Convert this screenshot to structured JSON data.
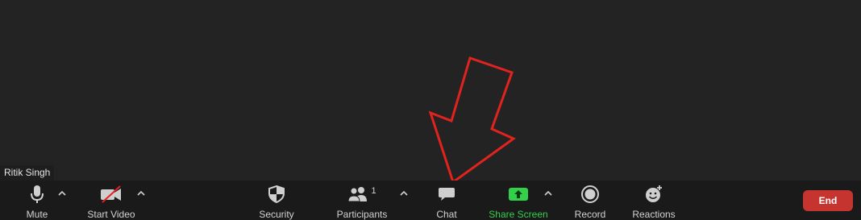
{
  "participant_name": "Ritik Singh",
  "colors": {
    "background": "#232323",
    "toolbar": "#1a1a1a",
    "end_button": "#c5342f",
    "share_screen": "#33d04a",
    "annotation_arrow": "#e0231f"
  },
  "toolbar": {
    "mute": {
      "label": "Mute",
      "icon": "microphone-icon"
    },
    "start_video": {
      "label": "Start Video",
      "icon": "video-off-icon"
    },
    "security": {
      "label": "Security",
      "icon": "shield-icon"
    },
    "participants": {
      "label": "Participants",
      "count": "1",
      "icon": "participants-icon"
    },
    "chat": {
      "label": "Chat",
      "icon": "chat-icon"
    },
    "share_screen": {
      "label": "Share Screen",
      "icon": "share-screen-icon"
    },
    "record": {
      "label": "Record",
      "icon": "record-icon"
    },
    "reactions": {
      "label": "Reactions",
      "icon": "reactions-icon"
    },
    "end": {
      "label": "End"
    }
  },
  "annotation": {
    "icon": "red-arrow-annotation",
    "points_to": "Chat"
  }
}
